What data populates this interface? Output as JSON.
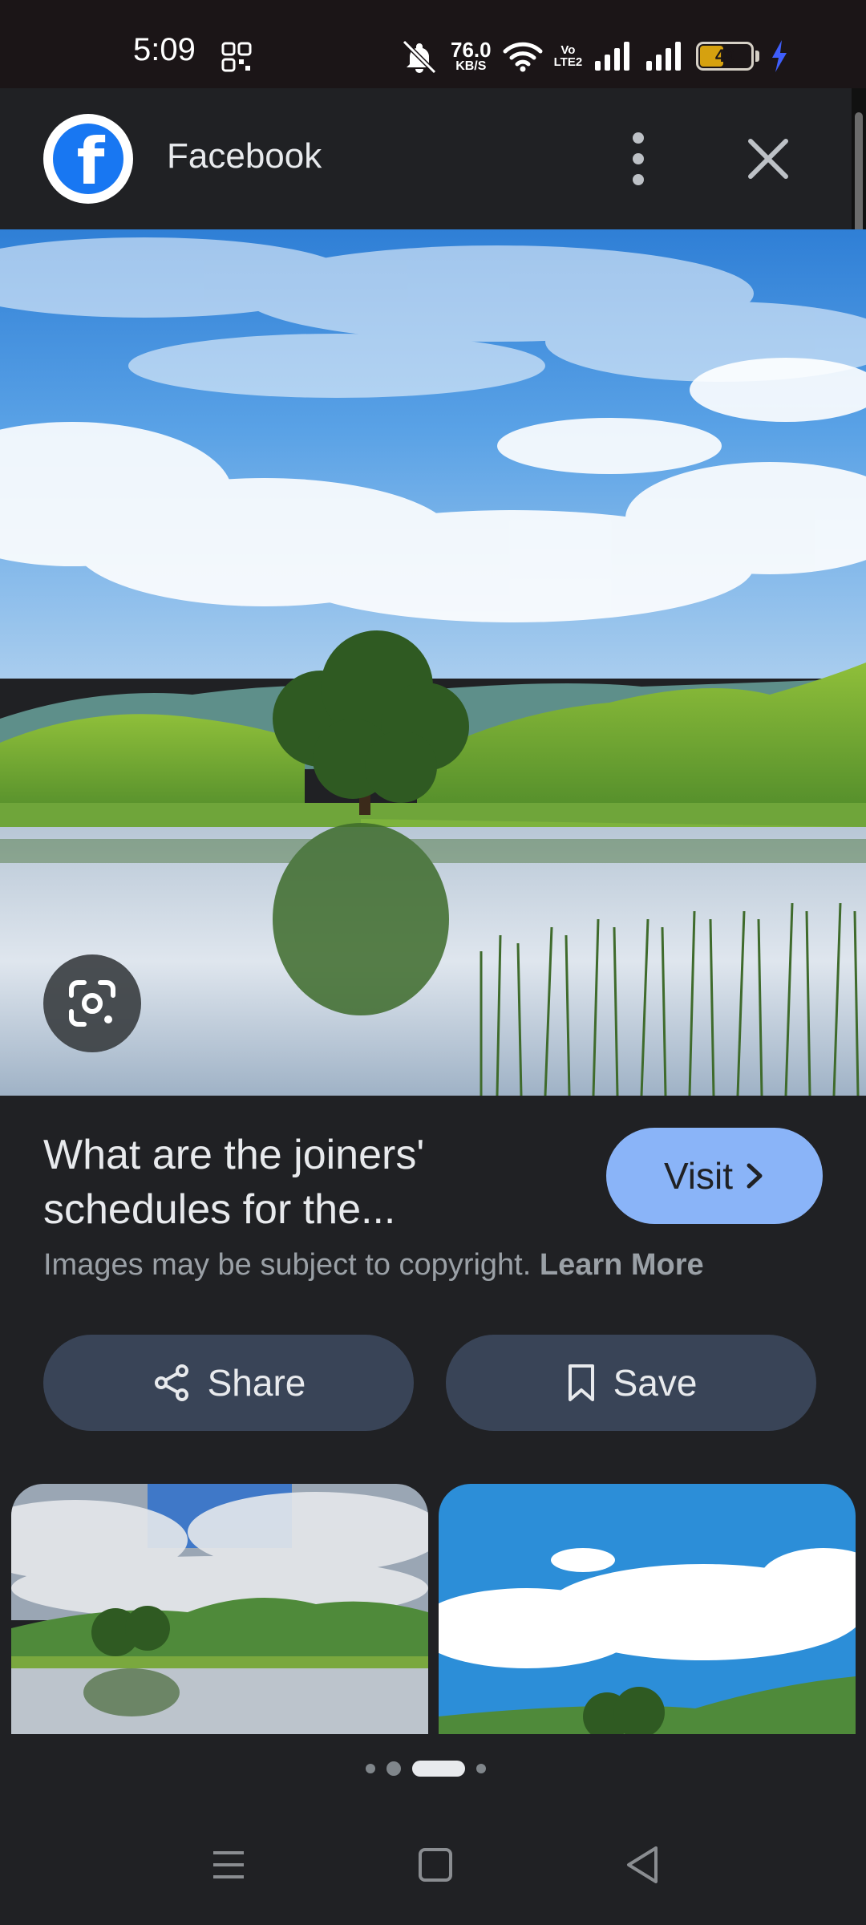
{
  "status_bar": {
    "time": "5:09",
    "net_speed_value": "76.0",
    "net_speed_unit": "KB/S",
    "volte_line1": "Vo",
    "volte_line2": "LTE2",
    "battery_level": "49",
    "battery_fraction": 0.49,
    "battery_color": "#d6a10f",
    "charging_color": "#3f5efb",
    "icons": [
      "qr-code-icon",
      "mute-icon",
      "wifi-icon",
      "volte-icon",
      "signal-icon",
      "signal-icon",
      "battery-icon",
      "charging-icon"
    ]
  },
  "header": {
    "source_name": "Facebook",
    "source_logo": "facebook-logo",
    "logo_letter": "f",
    "more_icon": "more-vert-icon",
    "close_icon": "close-icon"
  },
  "image_viewer": {
    "lens_icon": "google-lens-icon"
  },
  "result": {
    "title_line1": "What are the joiners'",
    "title_line2": "schedules for the...",
    "visit_label": "Visit",
    "copyright_text": "Images may be subject to copyright.",
    "learn_more": "Learn More"
  },
  "actions": {
    "share_label": "Share",
    "save_label": "Save"
  },
  "related": {
    "thumbnail_count": 2
  },
  "pagination": {
    "count": 4,
    "active_index": 2
  },
  "nav_bar": {
    "buttons": [
      "menu-icon",
      "home-icon",
      "back-icon"
    ]
  },
  "colors": {
    "background": "#202124",
    "accent": "#8ab4f8",
    "action_button": "#394457",
    "facebook_blue": "#1877f2"
  }
}
